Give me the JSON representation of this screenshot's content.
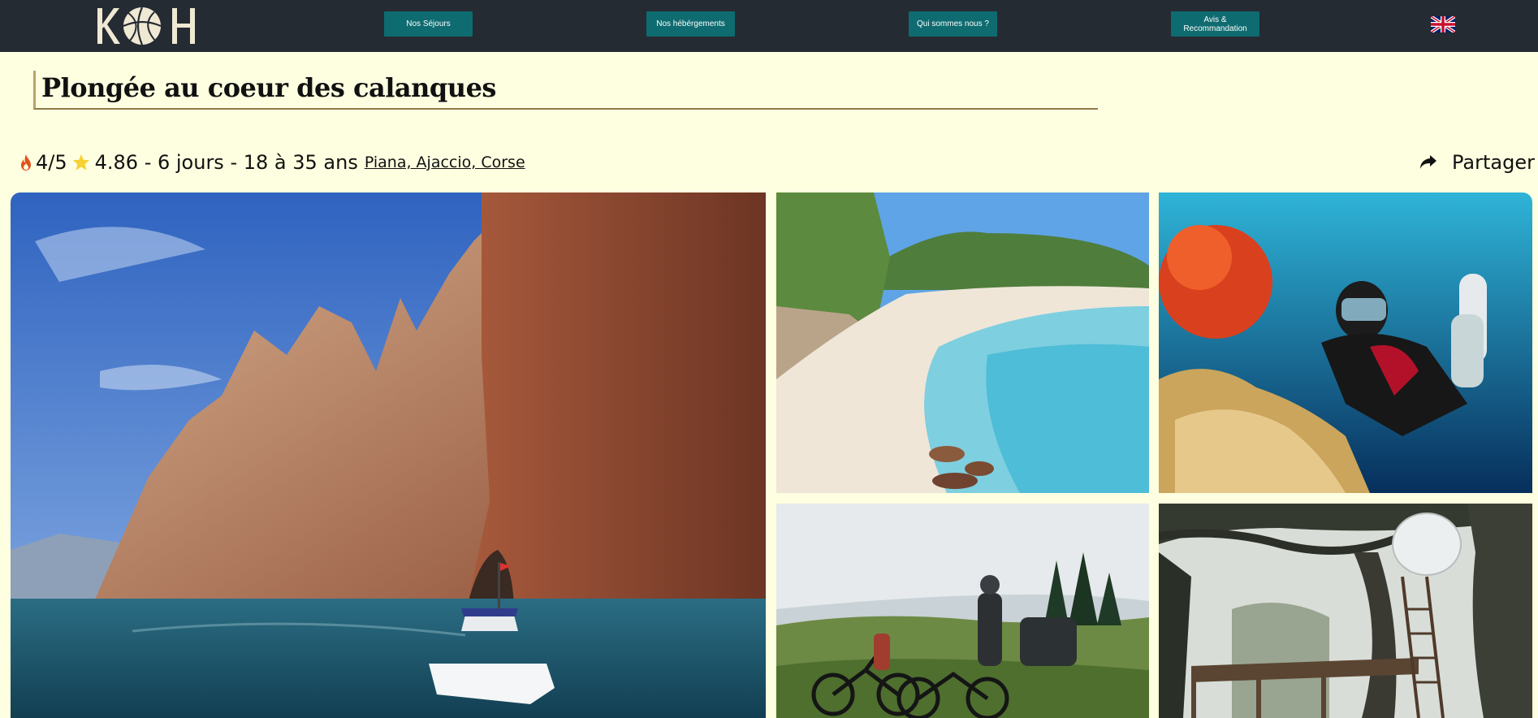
{
  "header": {
    "logo_text": "KOH",
    "nav": [
      {
        "label": "Nos Séjours"
      },
      {
        "label": "Nos hébérgements"
      },
      {
        "label": "Qui sommes nous ?"
      },
      {
        "label_line1": "Avis &",
        "label_line2": "Recommandation"
      }
    ],
    "language_icon": "uk-flag-icon"
  },
  "trip": {
    "title": "Plongée au coeur des calanques",
    "difficulty": "4/5",
    "difficulty_icon": "flame-icon",
    "rating_icon": "star-icon",
    "summary": "4.86 - 6 jours - 18 à 35 ans",
    "location": "Piana, Ajaccio, Corse",
    "share_label": "Partager",
    "share_icon": "share-icon"
  },
  "gallery": [
    {
      "subject": "rocky-cliffs-boat-photo"
    },
    {
      "subject": "beach-photo"
    },
    {
      "subject": "scuba-diver-photo"
    },
    {
      "subject": "mountain-bikers-photo"
    },
    {
      "subject": "tree-house-photo"
    }
  ],
  "colors": {
    "nav_bg": "#252b33",
    "nav_button": "#0e6b70",
    "page_bg": "#fefee0",
    "title_rule": "#8d7a47",
    "flame": "#e0531b",
    "star": "#f7d233"
  }
}
